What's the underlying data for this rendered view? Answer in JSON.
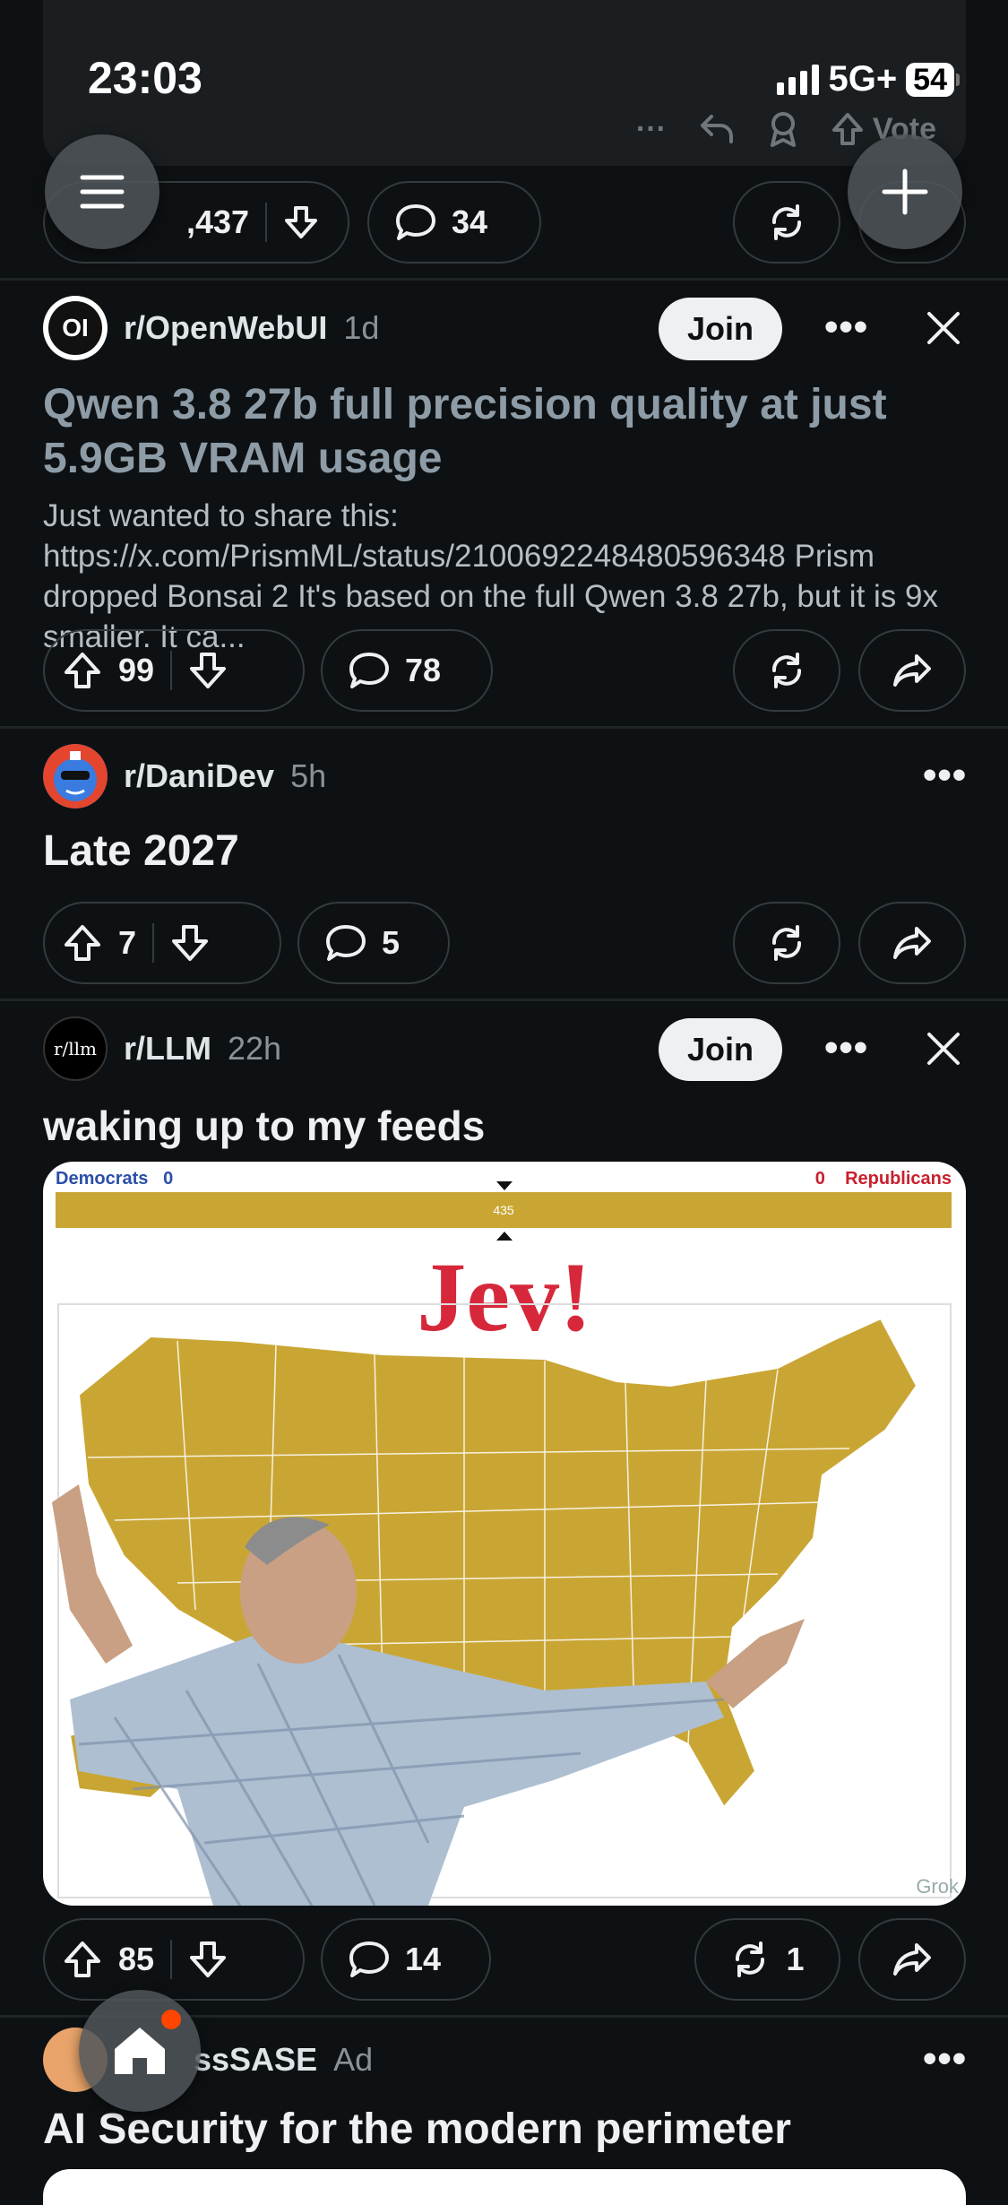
{
  "status_bar": {
    "time": "23:03",
    "network": "5G+",
    "battery": "54"
  },
  "top_card": {
    "vote_label": "Vote",
    "upvotes": ",437",
    "comments": "34"
  },
  "posts": [
    {
      "subreddit": "r/OpenWebUI",
      "avatar_text": "OI",
      "age": "1d",
      "join": "Join",
      "title": "Qwen 3.8 27b full precision quality at just 5.9GB VRAM usage",
      "body": "Just wanted to share this: https://x.com/PrismML/status/2100692248480596348 Prism dropped Bonsai 2 It's based on the full Qwen 3.8 27b, but it is 9x smaller. It ca...",
      "upvotes": "99",
      "comments": "78"
    },
    {
      "subreddit": "r/DaniDev",
      "age": "5h",
      "title": "Late 2027",
      "upvotes": "7",
      "comments": "5"
    },
    {
      "subreddit": "r/LLM",
      "avatar_text": "r/llm",
      "age": "22h",
      "join": "Join",
      "title": "waking up to my feeds",
      "image": {
        "left_label": "Democrats",
        "left_value": "0",
        "right_value": "0",
        "right_label": "Republicans",
        "center_value": "435",
        "headline": "Jev!",
        "watermark": "Grok"
      },
      "upvotes": "85",
      "comments": "14",
      "crossposts": "1"
    },
    {
      "subreddit": "ssSASE",
      "ad": "Ad",
      "title": "AI Security for the modern perimeter"
    }
  ],
  "colors": {
    "accent_red": "#d7283b",
    "map_gold": "#c9a634",
    "background": "#0e1113"
  }
}
